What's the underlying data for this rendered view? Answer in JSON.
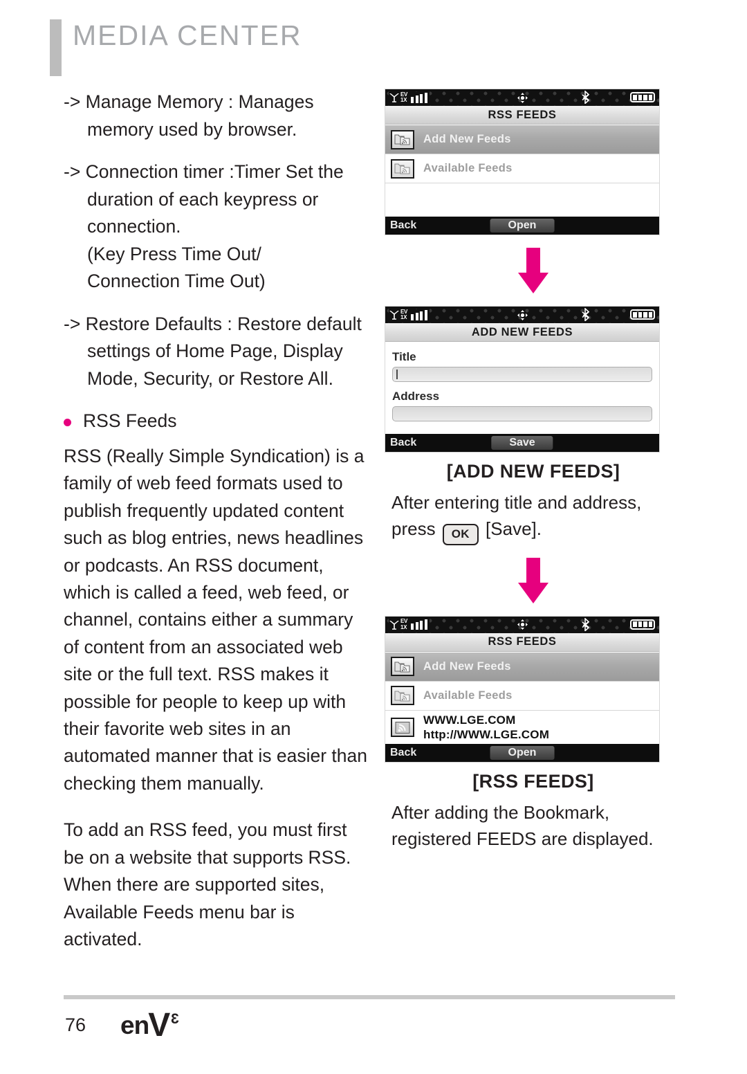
{
  "header": {
    "title": "MEDIA CENTER"
  },
  "left_column": {
    "sub_items": [
      {
        "marker": "->",
        "text": "Manage Memory : Manages memory used by browser."
      },
      {
        "marker": "->",
        "text": "Connection timer :Timer Set the duration of each keypress or connection.",
        "extra_lines": "(Key Press Time Out/ Connection Time Out)"
      },
      {
        "marker": "->",
        "text": "Restore Defaults : Restore default settings of Home Page, Display Mode, Security, or Restore All."
      }
    ],
    "bullet": {
      "dot_color": "#e6007e",
      "label": "RSS Feeds"
    },
    "paragraphs": [
      "RSS (Really Simple Syndication) is a family of web feed formats used to publish frequently updated content such as blog entries, news headlines or podcasts. An RSS document, which is called a feed, web feed, or channel, contains either a summary of content from an associated web site or the full text. RSS makes it possible for people to keep up with their favorite web sites in an automated manner that is easier than checking them manually.",
      "To add an RSS feed, you must first be on a website that supports RSS. When there are supported sites, Available Feeds menu bar is activated."
    ]
  },
  "right_column": {
    "screen1": {
      "status_bar": {
        "signal": "EV / 1X",
        "signal_bars": 4,
        "location_icon": "location-icon",
        "bluetooth_icon": "bluetooth-icon",
        "battery_bars": 4
      },
      "title": "RSS FEEDS",
      "rows": [
        {
          "icon": "feed-folder-icon",
          "label": "Add New Feeds",
          "selected": true
        },
        {
          "icon": "feed-folder-icon",
          "label": "Available Feeds",
          "selected": false
        }
      ],
      "softkey_left": "Back",
      "softkey_center": "Open"
    },
    "screen2": {
      "status_bar": {
        "signal": "EV / 1X",
        "signal_bars": 4,
        "location_icon": "location-icon",
        "bluetooth_icon": "bluetooth-icon",
        "battery_bars": 4
      },
      "title": "ADD NEW FEEDS",
      "fields": [
        {
          "label": "Title",
          "value": "",
          "focused": true
        },
        {
          "label": "Address",
          "value": "",
          "focused": false
        }
      ],
      "softkey_left": "Back",
      "softkey_center": "Save"
    },
    "screen3": {
      "status_bar": {
        "signal": "EV / 1X",
        "signal_bars": 4,
        "location_icon": "location-icon",
        "bluetooth_icon": "bluetooth-icon",
        "battery_bars": 4
      },
      "title": "RSS FEEDS",
      "rows": [
        {
          "icon": "feed-folder-icon",
          "label": "Add New Feeds",
          "selected": true
        },
        {
          "icon": "feed-folder-icon",
          "label": "Available Feeds",
          "selected": false
        }
      ],
      "feed_entry": {
        "icon": "rss-icon",
        "name": "WWW.LGE.COM",
        "url": "http://WWW.LGE.COM"
      },
      "softkey_left": "Back",
      "softkey_center": "Open"
    },
    "caption1": {
      "title": "[ADD NEW FEEDS]",
      "line1": "After entering title and address,",
      "line2_prefix": "press",
      "key": "OK",
      "line2_suffix": "[Save]."
    },
    "caption2": {
      "title": "[RSS FEEDS]",
      "line1": "After adding the Bookmark,",
      "line2": "registered FEEDS are displayed."
    },
    "arrow_color": "#e6007e"
  },
  "footer": {
    "page_number": "76",
    "logo_en": "en",
    "logo_v": "V",
    "logo_sup": "3"
  }
}
